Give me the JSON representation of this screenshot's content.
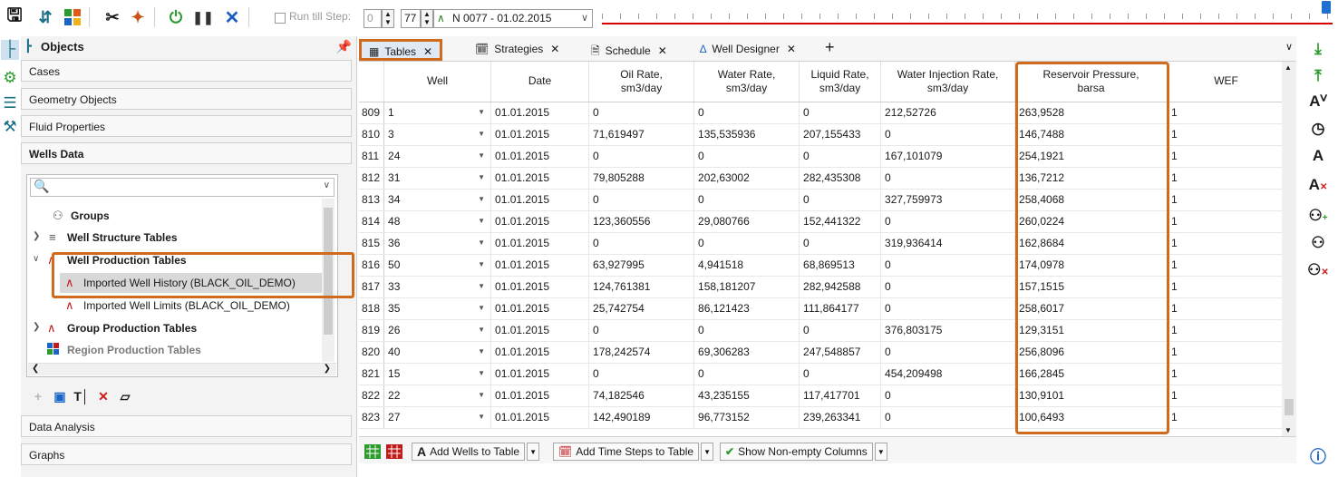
{
  "toolbar": {
    "run_till_step_label": "Run till Step:",
    "start_step": "0",
    "end_step": "77",
    "current_step_label": "N 0077 - 01.02.2015"
  },
  "objects_panel": {
    "title": "Objects",
    "sections_top": [
      "Cases",
      "Geometry Objects",
      "Fluid Properties",
      "Wells Data"
    ],
    "search_placeholder": "",
    "tree": [
      {
        "label": "Groups",
        "icon": "groups-icon"
      },
      {
        "label": "Well Structure Tables",
        "icon": "well-structure-icon"
      },
      {
        "label": "Well Production Tables",
        "icon": "well-production-icon"
      },
      {
        "label": "Imported Well History (BLACK_OIL_DEMO)",
        "icon": "well-history-icon"
      },
      {
        "label": "Imported Well Limits (BLACK_OIL_DEMO)",
        "icon": "well-limits-icon"
      },
      {
        "label": "Group Production Tables",
        "icon": "group-production-icon"
      },
      {
        "label": "Region Production Tables",
        "icon": "region-production-icon"
      }
    ],
    "sections_bottom": [
      "Data Analysis",
      "Graphs"
    ]
  },
  "tabs": [
    {
      "label": "Tables",
      "icon": "table-icon"
    },
    {
      "label": "Strategies",
      "icon": "calendar-icon"
    },
    {
      "label": "Schedule",
      "icon": "document-icon"
    },
    {
      "label": "Well Designer",
      "icon": "well-icon"
    }
  ],
  "table": {
    "columns": [
      {
        "label": "",
        "key": "row"
      },
      {
        "label": "Well",
        "key": "well"
      },
      {
        "label": "Date",
        "key": "date"
      },
      {
        "label": "Oil Rate,\nsm3/day",
        "key": "oil"
      },
      {
        "label": "Water Rate,\nsm3/day",
        "key": "water"
      },
      {
        "label": "Liquid Rate,\nsm3/day",
        "key": "liquid"
      },
      {
        "label": "Water Injection Rate,\nsm3/day",
        "key": "winj"
      },
      {
        "label": "Reservoir Pressure,\nbarsa",
        "key": "pres"
      },
      {
        "label": "WEF",
        "key": "wef"
      }
    ],
    "rows": [
      [
        "809",
        "1",
        "01.01.2015",
        "0",
        "0",
        "0",
        "212,52726",
        "263,9528",
        "1"
      ],
      [
        "810",
        "3",
        "01.01.2015",
        "71,619497",
        "135,535936",
        "207,155433",
        "0",
        "146,7488",
        "1"
      ],
      [
        "811",
        "24",
        "01.01.2015",
        "0",
        "0",
        "0",
        "167,101079",
        "254,1921",
        "1"
      ],
      [
        "812",
        "31",
        "01.01.2015",
        "79,805288",
        "202,63002",
        "282,435308",
        "0",
        "136,7212",
        "1"
      ],
      [
        "813",
        "34",
        "01.01.2015",
        "0",
        "0",
        "0",
        "327,759973",
        "258,4068",
        "1"
      ],
      [
        "814",
        "48",
        "01.01.2015",
        "123,360556",
        "29,080766",
        "152,441322",
        "0",
        "260,0224",
        "1"
      ],
      [
        "815",
        "36",
        "01.01.2015",
        "0",
        "0",
        "0",
        "319,936414",
        "162,8684",
        "1"
      ],
      [
        "816",
        "50",
        "01.01.2015",
        "63,927995",
        "4,941518",
        "68,869513",
        "0",
        "174,0978",
        "1"
      ],
      [
        "817",
        "33",
        "01.01.2015",
        "124,761381",
        "158,181207",
        "282,942588",
        "0",
        "157,1515",
        "1"
      ],
      [
        "818",
        "35",
        "01.01.2015",
        "25,742754",
        "86,121423",
        "111,864177",
        "0",
        "258,6017",
        "1"
      ],
      [
        "819",
        "26",
        "01.01.2015",
        "0",
        "0",
        "0",
        "376,803175",
        "129,3151",
        "1"
      ],
      [
        "820",
        "40",
        "01.01.2015",
        "178,242574",
        "69,306283",
        "247,548857",
        "0",
        "256,8096",
        "1"
      ],
      [
        "821",
        "15",
        "01.01.2015",
        "0",
        "0",
        "0",
        "454,209498",
        "166,2845",
        "1"
      ],
      [
        "822",
        "22",
        "01.01.2015",
        "74,182546",
        "43,235155",
        "117,417701",
        "0",
        "130,9101",
        "1"
      ],
      [
        "823",
        "27",
        "01.01.2015",
        "142,490189",
        "96,773152",
        "239,263341",
        "0",
        "100,6493",
        "1"
      ]
    ]
  },
  "bottom_toolbar": {
    "add_wells": "Add Wells to Table",
    "add_time_steps": "Add Time Steps to Table",
    "show_nonempty": "Show Non-empty Columns"
  },
  "colors": {
    "highlight": "#d06a1c",
    "timeline_track": "#d60000",
    "timeline_handle": "#1f6fd1"
  }
}
